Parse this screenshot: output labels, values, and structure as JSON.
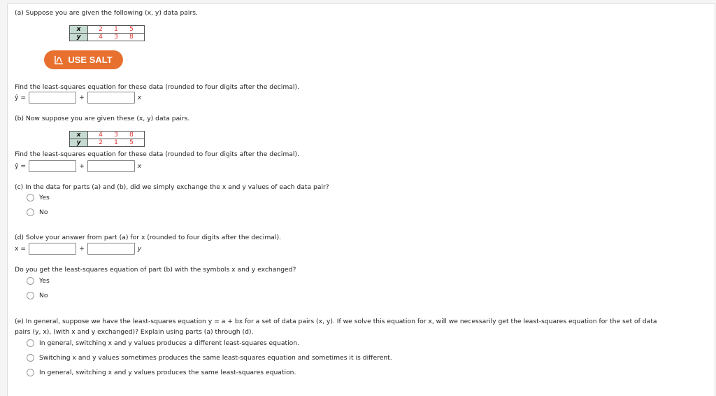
{
  "part_a": {
    "prompt": "(a) Suppose you are given the following (x, y) data pairs.",
    "table": {
      "x_label": "x",
      "y_label": "y",
      "x": [
        "2",
        "1",
        "5"
      ],
      "y": [
        "4",
        "3",
        "8"
      ]
    },
    "salt_button": "USE SALT",
    "find_prompt": "Find the least-squares equation for these data (rounded to four digits after the decimal).",
    "lhs": "ŷ =",
    "plus": "+",
    "var": "x",
    "intercept_value": "",
    "slope_value": ""
  },
  "part_b": {
    "prompt": "(b) Now suppose you are given these (x, y) data pairs.",
    "table": {
      "x_label": "x",
      "y_label": "y",
      "x": [
        "4",
        "3",
        "8"
      ],
      "y": [
        "2",
        "1",
        "5"
      ]
    },
    "find_prompt": "Find the least-squares equation for these data (rounded to four digits after the decimal).",
    "lhs": "ŷ =",
    "plus": "+",
    "var": "x",
    "intercept_value": "",
    "slope_value": ""
  },
  "part_c": {
    "prompt": "(c) In the data for parts (a) and (b), did we simply exchange the x and y values of each data pair?",
    "options": [
      "Yes",
      "No"
    ]
  },
  "part_d": {
    "prompt": "(d) Solve your answer from part (a) for x (rounded to four digits after the decimal).",
    "lhs": "x =",
    "plus": "+",
    "var": "y",
    "intercept_value": "",
    "slope_value": "",
    "followup": "Do you get the least-squares equation of part (b) with the symbols x and y exchanged?",
    "options": [
      "Yes",
      "No"
    ]
  },
  "part_e": {
    "prompt_line1": "(e) In general, suppose we have the least-squares equation y = a + bx for a set of data pairs (x, y). If we solve this equation for x, will we necessarily get the least-squares equation for the set of data",
    "prompt_line2": "pairs (y, x), (with x and y exchanged)? Explain using parts (a) through (d).",
    "options": [
      "In general, switching x and y values produces a different least-squares equation.",
      "Switching x and y values sometimes produces the same least-squares equation and sometimes it is different.",
      "In general, switching x and y values produces the same least-squares equation."
    ]
  }
}
